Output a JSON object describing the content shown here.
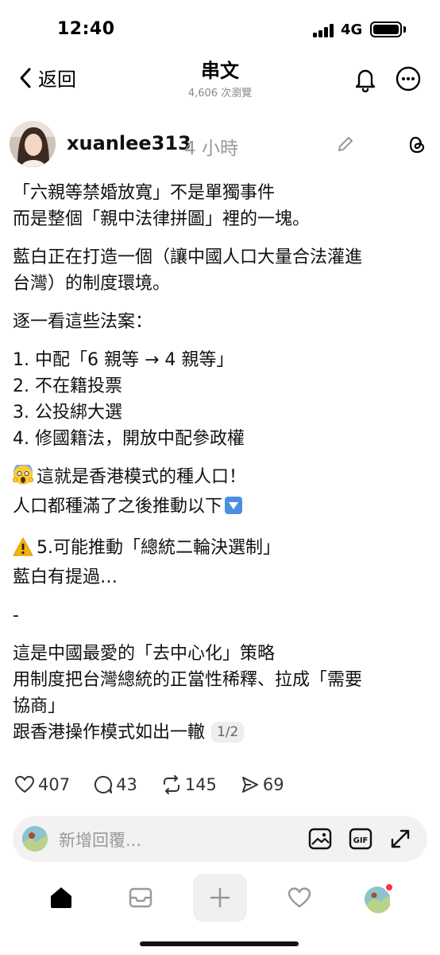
{
  "status_bar": {
    "time": "12:40",
    "network": "4G"
  },
  "header": {
    "back_label": "返回",
    "title": "串文",
    "views": "4,606 次瀏覽"
  },
  "post": {
    "username": "xuanlee313",
    "time_ago": "4 小時",
    "lines": [
      "「六親等禁婚放寬」不是單獨事件",
      "而是整個「親中法律拼圖」裡的一塊。",
      "藍白正在打造一個（讓中國人口大量合法灌進",
      "台灣）的制度環境。",
      "逐一看這些法案：",
      "1. 中配「6 親等 → 4 親等」",
      "2. 不在籍投票",
      "3. 公投綁大選",
      "4. 修國籍法，開放中配參政權",
      "這就是香港模式的種人口！",
      "人口都種滿了之後推動以下",
      "5.可能推動「總統二輪決選制」",
      "藍白有提過…",
      "-",
      "這是中國最愛的「去中心化」策略",
      "用制度把台灣總統的正當性稀釋、拉成「需要",
      "協商」",
      "跟香港操作模式如出一轍"
    ],
    "page_indicator": "1/2"
  },
  "actions": {
    "likes": "407",
    "comments": "43",
    "reposts": "145",
    "shares": "69"
  },
  "reply": {
    "placeholder": "新增回覆...",
    "gif_label": "GIF"
  }
}
